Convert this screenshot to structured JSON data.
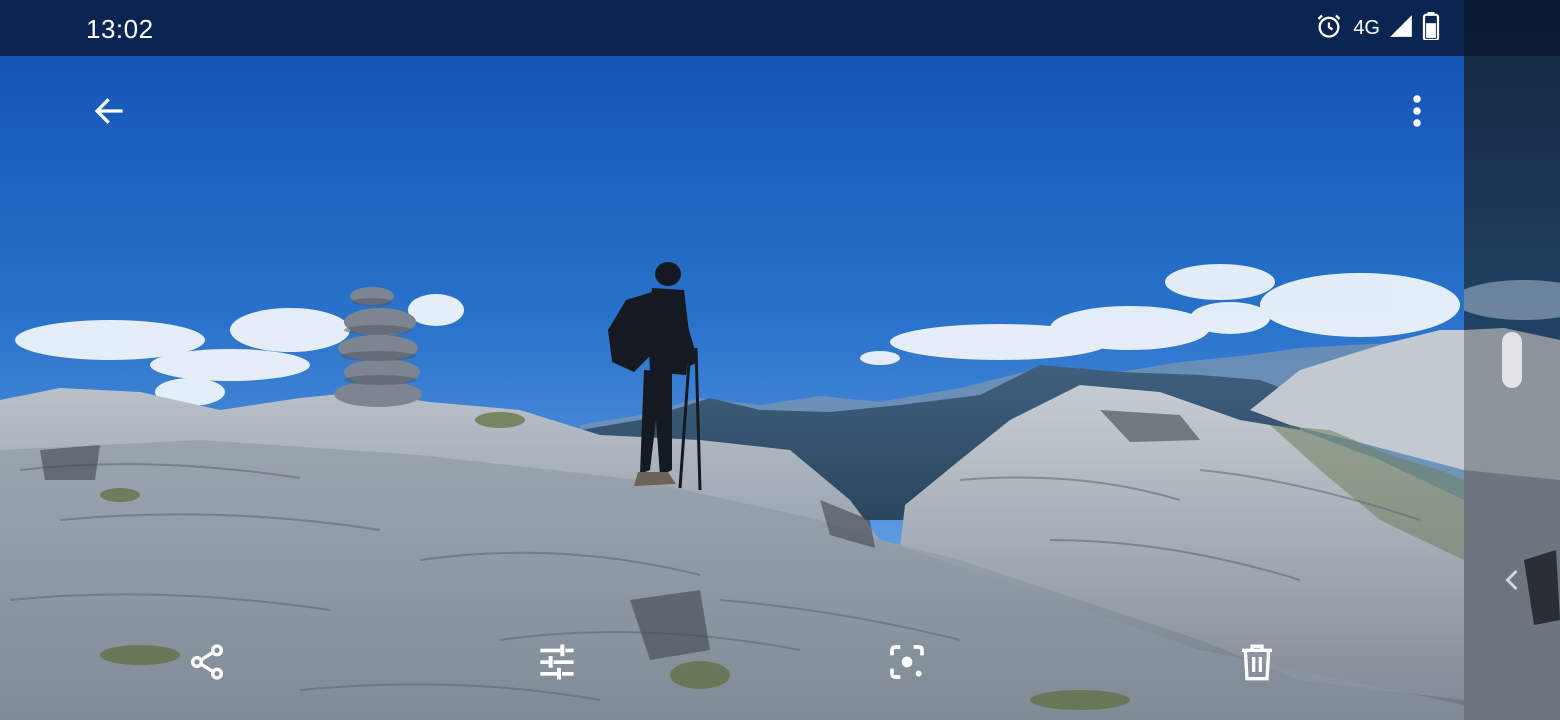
{
  "status_bar": {
    "time": "13:02",
    "network": "4G",
    "icons": [
      "alarm-icon",
      "signal-icon",
      "battery-icon"
    ]
  },
  "top_bar": {
    "back_icon": "arrow-left-icon",
    "more_icon": "more-vertical-icon"
  },
  "photo": {
    "description_hidden": true
  },
  "toolbar": {
    "items": [
      {
        "id": "share",
        "icon": "share-icon"
      },
      {
        "id": "edit",
        "icon": "tune-icon"
      },
      {
        "id": "lens",
        "icon": "lens-icon"
      },
      {
        "id": "delete",
        "icon": "trash-icon"
      }
    ]
  },
  "colors": {
    "sky_top": "#1256b8",
    "sky_bottom": "#3f86d6",
    "rock": "#9aa3ad",
    "status_bar_bg": "#0b1830",
    "icon": "#ffffff"
  }
}
